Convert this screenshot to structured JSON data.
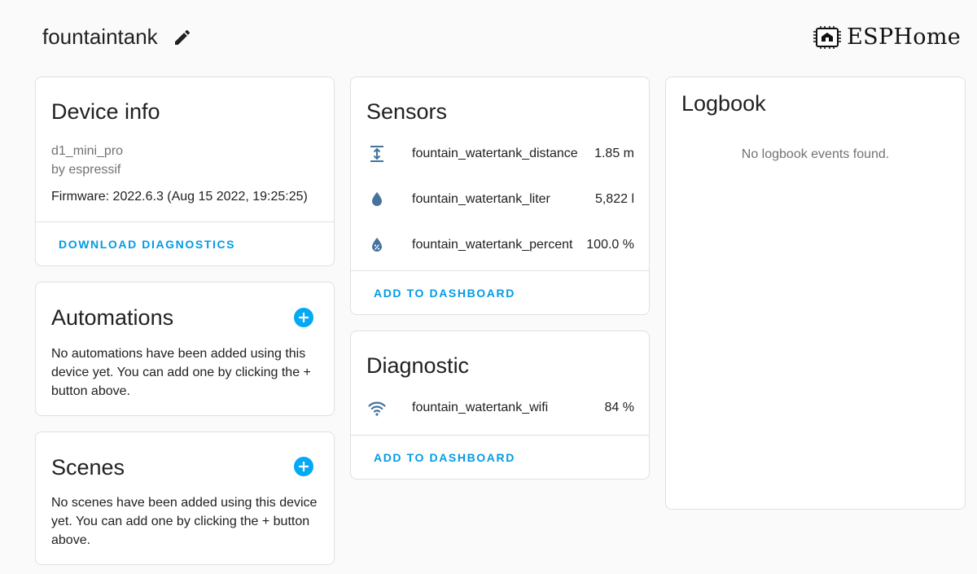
{
  "header": {
    "device_name": "fountaintank",
    "brand_name": "ESPHome"
  },
  "device_info": {
    "title": "Device info",
    "model": "d1_mini_pro",
    "manufacturer": "by espressif",
    "firmware": "Firmware: 2022.6.3 (Aug 15 2022, 19:25:25)",
    "action": "DOWNLOAD DIAGNOSTICS"
  },
  "automations": {
    "title": "Automations",
    "text": "No automations have been added using this device yet. You can add one by clicking the + button above."
  },
  "scenes": {
    "title": "Scenes",
    "text": "No scenes have been added using this device yet. You can add one by clicking the + button above."
  },
  "sensors": {
    "title": "Sensors",
    "rows": [
      {
        "name": "fountain_watertank_distance",
        "value": "1.85 m",
        "icon": "arrow-expand-vertical-icon"
      },
      {
        "name": "fountain_watertank_liter",
        "value": "5,822 l",
        "icon": "water-drop-icon"
      },
      {
        "name": "fountain_watertank_percent",
        "value": "100.0 %",
        "icon": "water-percent-icon"
      }
    ],
    "action": "ADD TO DASHBOARD"
  },
  "diagnostic": {
    "title": "Diagnostic",
    "rows": [
      {
        "name": "fountain_watertank_wifi",
        "value": "84 %",
        "icon": "wifi-icon"
      }
    ],
    "action": "ADD TO DASHBOARD"
  },
  "logbook": {
    "title": "Logbook",
    "empty_text": "No logbook events found."
  },
  "colors": {
    "accent": "#03a9f4",
    "icon": "#44739e",
    "text": "#212121",
    "muted": "#727272"
  }
}
